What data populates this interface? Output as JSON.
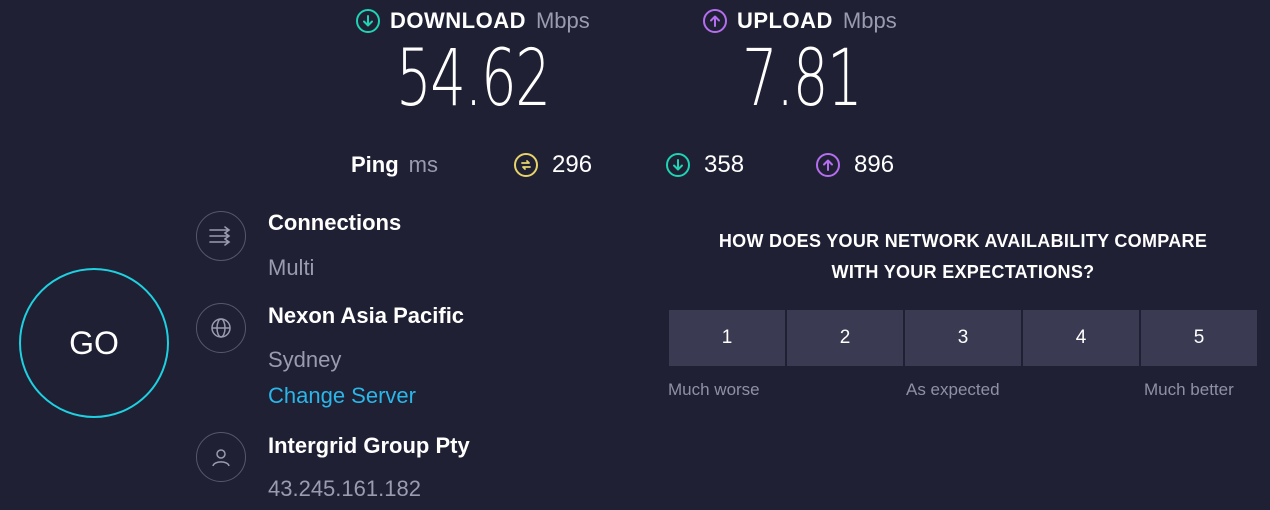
{
  "download": {
    "label": "DOWNLOAD",
    "unit": "Mbps",
    "value": "54.62",
    "icon": "download-icon",
    "color": "#1fd3b5"
  },
  "upload": {
    "label": "UPLOAD",
    "unit": "Mbps",
    "value": "7.81",
    "icon": "upload-icon",
    "color": "#b56ef0"
  },
  "ping": {
    "label": "Ping",
    "unit": "ms",
    "idle": {
      "value": "296",
      "icon": "ping-idle-icon",
      "color": "#e8d36b"
    },
    "download": {
      "value": "358",
      "icon": "download-icon",
      "color": "#1fd3b5"
    },
    "upload": {
      "value": "896",
      "icon": "upload-icon",
      "color": "#b56ef0"
    }
  },
  "go_button": {
    "label": "GO",
    "ring_color": "#1fd0e0"
  },
  "connections": {
    "title": "Connections",
    "value": "Multi",
    "icon": "connections-icon"
  },
  "server": {
    "title": "Nexon Asia Pacific",
    "location": "Sydney",
    "change_link": "Change Server",
    "icon": "globe-icon"
  },
  "provider": {
    "title": "Intergrid Group Pty",
    "ip": "43.245.161.182",
    "icon": "user-icon"
  },
  "survey": {
    "question_line1": "HOW DOES YOUR NETWORK AVAILABILITY COMPARE",
    "question_line2": "WITH YOUR EXPECTATIONS?",
    "options": [
      "1",
      "2",
      "3",
      "4",
      "5"
    ],
    "captions": {
      "low": "Much worse",
      "mid": "As expected",
      "high": "Much better"
    }
  }
}
